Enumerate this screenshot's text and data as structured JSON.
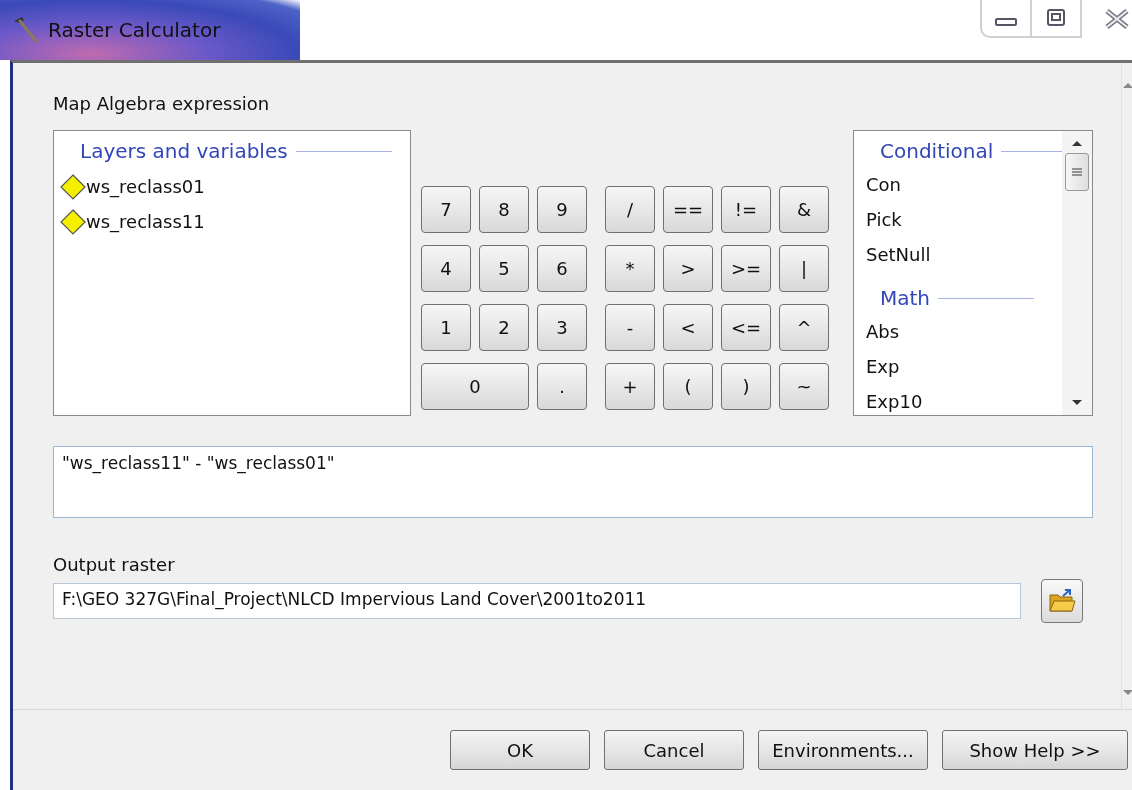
{
  "window": {
    "title": "Raster Calculator"
  },
  "expression_label": "Map Algebra expression",
  "layers": {
    "header": "Layers and variables",
    "items": [
      {
        "name": "ws_reclass01"
      },
      {
        "name": "ws_reclass11"
      }
    ]
  },
  "number_keys": [
    {
      "label": "7",
      "wide": false
    },
    {
      "label": "8",
      "wide": false
    },
    {
      "label": "9",
      "wide": false
    },
    {
      "label": "4",
      "wide": false
    },
    {
      "label": "5",
      "wide": false
    },
    {
      "label": "6",
      "wide": false
    },
    {
      "label": "1",
      "wide": false
    },
    {
      "label": "2",
      "wide": false
    },
    {
      "label": "3",
      "wide": false
    },
    {
      "label": "0",
      "wide": true
    },
    {
      "label": ".",
      "wide": false
    }
  ],
  "operator_keys": [
    "/",
    "==",
    "!=",
    "&",
    "*",
    ">",
    ">=",
    "|",
    "-",
    "<",
    "<=",
    "^",
    "+",
    "(",
    ")",
    "~"
  ],
  "functions": [
    {
      "kind": "header",
      "label": "Conditional"
    },
    {
      "kind": "item",
      "label": "Con"
    },
    {
      "kind": "item",
      "label": "Pick"
    },
    {
      "kind": "item",
      "label": "SetNull"
    },
    {
      "kind": "header",
      "label": "Math"
    },
    {
      "kind": "item",
      "label": "Abs"
    },
    {
      "kind": "item",
      "label": "Exp"
    },
    {
      "kind": "item",
      "label": "Exp10"
    }
  ],
  "expression": "\"ws_reclass11\" - \"ws_reclass01\"",
  "output": {
    "label": "Output raster",
    "value": "F:\\GEO 327G\\Final_Project\\NLCD Impervious Land Cover\\2001to2011"
  },
  "buttons": [
    "OK",
    "Cancel",
    "Environments...",
    "Show Help >>"
  ]
}
